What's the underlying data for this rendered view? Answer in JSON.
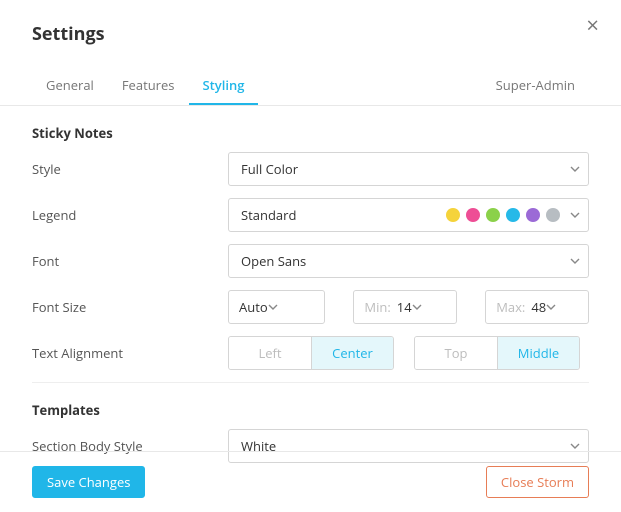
{
  "title": "Settings",
  "tabs": {
    "general": "General",
    "features": "Features",
    "styling": "Styling",
    "super_admin": "Super-Admin"
  },
  "sticky_notes": {
    "section": "Sticky Notes",
    "style": {
      "label": "Style",
      "value": "Full Color"
    },
    "legend": {
      "label": "Legend",
      "value": "Standard",
      "colors": [
        "#f5d33b",
        "#ee4e95",
        "#8bd14a",
        "#26b9e8",
        "#9b6ad6",
        "#b7bdc2"
      ]
    },
    "font": {
      "label": "Font",
      "value": "Open Sans"
    },
    "font_size": {
      "label": "Font Size",
      "auto": "Auto",
      "min_label": "Min:",
      "min_value": "14",
      "max_label": "Max:",
      "max_value": "48"
    },
    "alignment": {
      "label": "Text Alignment",
      "h": {
        "left": "Left",
        "center": "Center"
      },
      "v": {
        "top": "Top",
        "middle": "Middle"
      }
    }
  },
  "templates": {
    "section": "Templates",
    "section_body_style": {
      "label": "Section Body Style",
      "value": "White"
    }
  },
  "footer": {
    "save": "Save Changes",
    "close": "Close Storm"
  }
}
